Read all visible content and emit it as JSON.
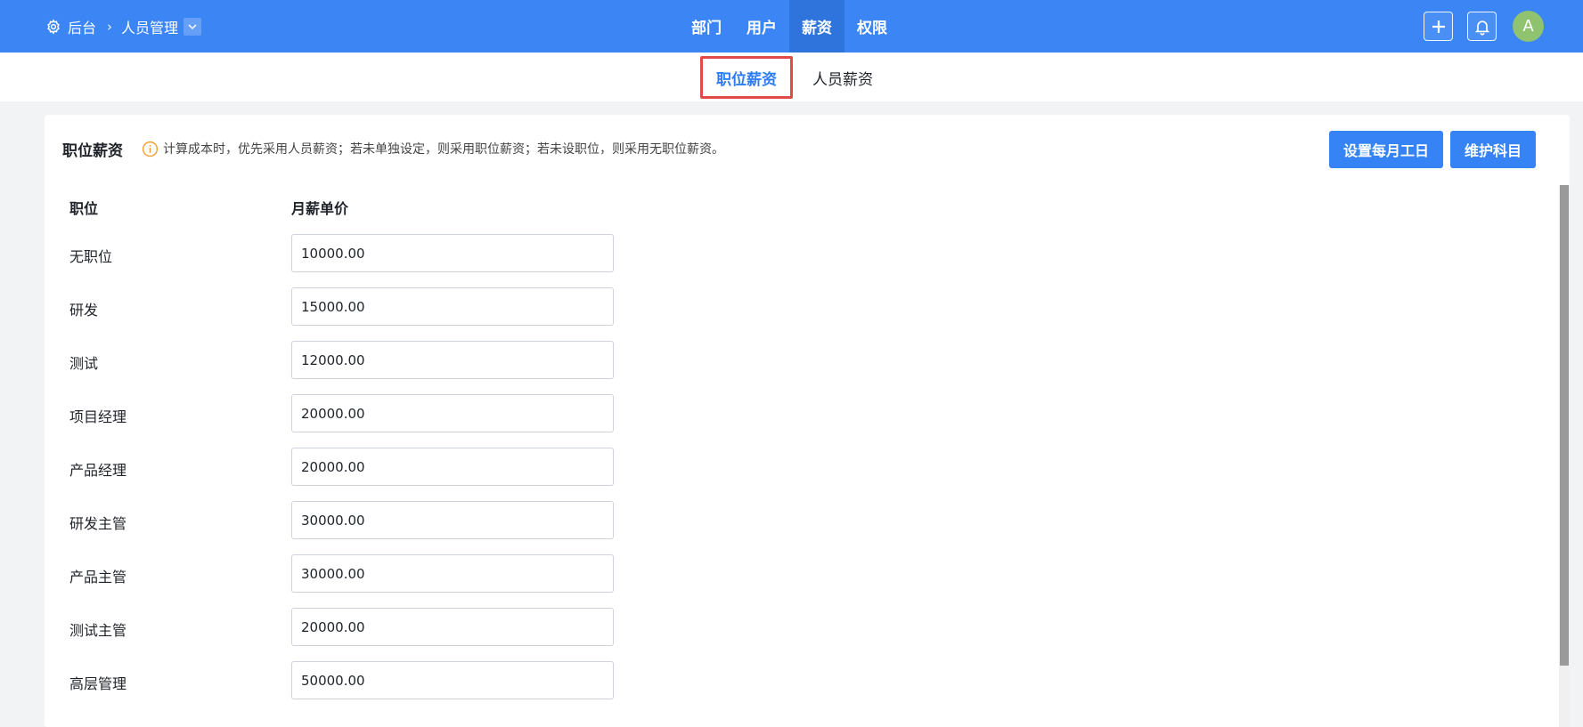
{
  "header": {
    "breadcrumb_root": "后台",
    "breadcrumb_current": "人员管理",
    "nav": [
      {
        "label": "部门"
      },
      {
        "label": "用户"
      },
      {
        "label": "薪资"
      },
      {
        "label": "权限"
      }
    ],
    "active_nav": "薪资",
    "avatar_letter": "A"
  },
  "subtabs": [
    {
      "label": "职位薪资"
    },
    {
      "label": "人员薪资"
    }
  ],
  "active_subtab": "职位薪资",
  "card": {
    "title": "职位薪资",
    "tip": "计算成本时，优先采用人员薪资；若未单独设定，则采用职位薪资；若未设职位，则采用无职位薪资。",
    "buttons": {
      "set_workdays": "设置每月工日",
      "maintain_subjects": "维护科目"
    },
    "columns": {
      "position": "职位",
      "monthly_salary": "月薪单价"
    },
    "rows": [
      {
        "position": "无职位",
        "salary": "10000.00"
      },
      {
        "position": "研发",
        "salary": "15000.00"
      },
      {
        "position": "测试",
        "salary": "12000.00"
      },
      {
        "position": "项目经理",
        "salary": "20000.00"
      },
      {
        "position": "产品经理",
        "salary": "20000.00"
      },
      {
        "position": "研发主管",
        "salary": "30000.00"
      },
      {
        "position": "产品主管",
        "salary": "30000.00"
      },
      {
        "position": "测试主管",
        "salary": "20000.00"
      },
      {
        "position": "高层管理",
        "salary": "50000.00"
      }
    ]
  },
  "colors": {
    "header_bg": "#3b86f4",
    "accent": "#2f7df5",
    "highlight_border": "#e04a4a",
    "avatar_bg": "#8fc36f"
  }
}
